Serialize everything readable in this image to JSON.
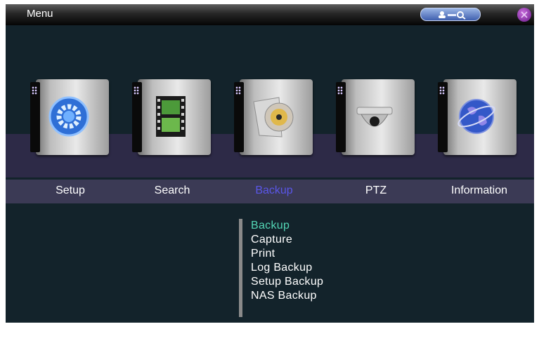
{
  "window": {
    "title": "Menu"
  },
  "titlebar": {
    "user_icon": "user-search-icon",
    "close_icon": "power-icon"
  },
  "menu": {
    "items": [
      {
        "label": "Setup",
        "icon": "gear-icon"
      },
      {
        "label": "Search",
        "icon": "film-icon"
      },
      {
        "label": "Backup",
        "icon": "disc-icon",
        "selected": true
      },
      {
        "label": "PTZ",
        "icon": "camera-icon"
      },
      {
        "label": "Information",
        "icon": "globe-icon"
      }
    ]
  },
  "submenu": {
    "items": [
      {
        "label": "Backup",
        "selected": true
      },
      {
        "label": "Capture"
      },
      {
        "label": "Print"
      },
      {
        "label": "Log Backup"
      },
      {
        "label": "Setup Backup"
      },
      {
        "label": "NAS Backup"
      }
    ]
  },
  "colors": {
    "selected_label": "#5a56e8",
    "selected_submenu": "#53d6b5",
    "background": "#13232b"
  }
}
